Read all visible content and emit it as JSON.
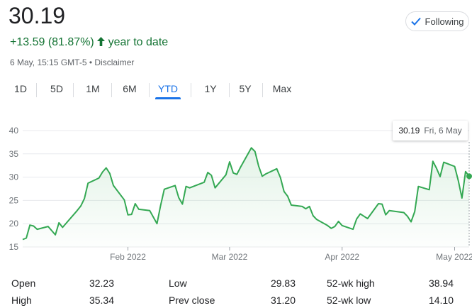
{
  "quote": {
    "price": "30.19",
    "change": "+13.59 (81.87%)",
    "change_arrow": "🡑",
    "period": "year to date",
    "timestamp": "6 May, 15:15 GMT-5 • Disclaimer"
  },
  "follow_button": {
    "label": "Following",
    "icon": "check-icon"
  },
  "tabs": [
    {
      "label": "1D",
      "active": false
    },
    {
      "label": "5D",
      "active": false
    },
    {
      "label": "1M",
      "active": false
    },
    {
      "label": "6M",
      "active": false
    },
    {
      "label": "YTD",
      "active": true
    },
    {
      "label": "1Y",
      "active": false
    },
    {
      "label": "5Y",
      "active": false
    },
    {
      "label": "Max",
      "active": false
    }
  ],
  "tooltip": {
    "price": "30.19",
    "date": "Fri, 6 May"
  },
  "stats": {
    "open_label": "Open",
    "open_value": "32.23",
    "high_label": "High",
    "high_value": "35.34",
    "low_label": "Low",
    "low_value": "29.83",
    "prev_close_label": "Prev close",
    "prev_close_value": "31.20",
    "wk52_high_label": "52-wk high",
    "wk52_high_value": "38.94",
    "wk52_low_label": "52-wk low",
    "wk52_low_value": "14.10"
  },
  "colors": {
    "line": "#34a853",
    "accent": "#1a73e8",
    "positive": "#137333"
  },
  "chart_data": {
    "type": "area",
    "title": "",
    "xlabel": "",
    "ylabel": "",
    "ylim": [
      15,
      40
    ],
    "yticks": [
      15,
      20,
      25,
      30,
      35,
      40
    ],
    "xticks": [
      {
        "label": "Feb 2022",
        "date": "2022-02-01"
      },
      {
        "label": "Mar 2022",
        "date": "2022-03-01"
      },
      {
        "label": "Apr 2022",
        "date": "2022-04-01"
      },
      {
        "label": "May 2022",
        "date": "2022-05-02"
      }
    ],
    "grid": true,
    "series": [
      {
        "values": [
          [
            "2022-01-03",
            16.6
          ],
          [
            "2022-01-04",
            16.9
          ],
          [
            "2022-01-05",
            19.7
          ],
          [
            "2022-01-06",
            19.5
          ],
          [
            "2022-01-07",
            18.8
          ],
          [
            "2022-01-10",
            19.4
          ],
          [
            "2022-01-11",
            18.5
          ],
          [
            "2022-01-12",
            17.6
          ],
          [
            "2022-01-13",
            20.2
          ],
          [
            "2022-01-14",
            19.2
          ],
          [
            "2022-01-18",
            22.8
          ],
          [
            "2022-01-19",
            23.8
          ],
          [
            "2022-01-20",
            25.4
          ],
          [
            "2022-01-21",
            28.7
          ],
          [
            "2022-01-24",
            29.8
          ],
          [
            "2022-01-25",
            31.1
          ],
          [
            "2022-01-26",
            32.0
          ],
          [
            "2022-01-27",
            30.8
          ],
          [
            "2022-01-28",
            28.2
          ],
          [
            "2022-01-31",
            25.1
          ],
          [
            "2022-02-01",
            21.9
          ],
          [
            "2022-02-02",
            22.0
          ],
          [
            "2022-02-03",
            24.3
          ],
          [
            "2022-02-04",
            23.1
          ],
          [
            "2022-02-07",
            22.8
          ],
          [
            "2022-02-08",
            21.4
          ],
          [
            "2022-02-09",
            20.0
          ],
          [
            "2022-02-10",
            23.9
          ],
          [
            "2022-02-11",
            27.4
          ],
          [
            "2022-02-14",
            28.2
          ],
          [
            "2022-02-15",
            25.6
          ],
          [
            "2022-02-16",
            24.2
          ],
          [
            "2022-02-17",
            28.0
          ],
          [
            "2022-02-18",
            27.7
          ],
          [
            "2022-02-22",
            28.9
          ],
          [
            "2022-02-23",
            31.0
          ],
          [
            "2022-02-24",
            30.4
          ],
          [
            "2022-02-25",
            27.7
          ],
          [
            "2022-02-28",
            30.5
          ],
          [
            "2022-03-01",
            33.3
          ],
          [
            "2022-03-02",
            30.9
          ],
          [
            "2022-03-03",
            30.6
          ],
          [
            "2022-03-04",
            32.1
          ],
          [
            "2022-03-07",
            36.3
          ],
          [
            "2022-03-08",
            35.5
          ],
          [
            "2022-03-09",
            32.4
          ],
          [
            "2022-03-10",
            30.2
          ],
          [
            "2022-03-11",
            30.7
          ],
          [
            "2022-03-14",
            31.8
          ],
          [
            "2022-03-15",
            29.9
          ],
          [
            "2022-03-16",
            26.9
          ],
          [
            "2022-03-17",
            25.9
          ],
          [
            "2022-03-18",
            24.0
          ],
          [
            "2022-03-21",
            23.7
          ],
          [
            "2022-03-22",
            23.2
          ],
          [
            "2022-03-23",
            23.7
          ],
          [
            "2022-03-24",
            21.7
          ],
          [
            "2022-03-25",
            20.9
          ],
          [
            "2022-03-28",
            19.6
          ],
          [
            "2022-03-29",
            19.0
          ],
          [
            "2022-03-30",
            19.4
          ],
          [
            "2022-03-31",
            20.5
          ],
          [
            "2022-04-01",
            19.6
          ],
          [
            "2022-04-04",
            18.8
          ],
          [
            "2022-04-05",
            21.0
          ],
          [
            "2022-04-06",
            22.1
          ],
          [
            "2022-04-07",
            21.6
          ],
          [
            "2022-04-08",
            21.1
          ],
          [
            "2022-04-11",
            24.3
          ],
          [
            "2022-04-12",
            24.2
          ],
          [
            "2022-04-13",
            21.9
          ],
          [
            "2022-04-14",
            22.8
          ],
          [
            "2022-04-18",
            22.4
          ],
          [
            "2022-04-19",
            21.6
          ],
          [
            "2022-04-20",
            20.4
          ],
          [
            "2022-04-21",
            22.6
          ],
          [
            "2022-04-22",
            28.0
          ],
          [
            "2022-04-25",
            27.3
          ],
          [
            "2022-04-26",
            33.4
          ],
          [
            "2022-04-27",
            31.9
          ],
          [
            "2022-04-28",
            30.1
          ],
          [
            "2022-04-29",
            33.2
          ],
          [
            "2022-05-02",
            32.3
          ],
          [
            "2022-05-03",
            29.3
          ],
          [
            "2022-05-04",
            25.5
          ],
          [
            "2022-05-05",
            31.2
          ],
          [
            "2022-05-06",
            30.19
          ]
        ]
      }
    ]
  }
}
